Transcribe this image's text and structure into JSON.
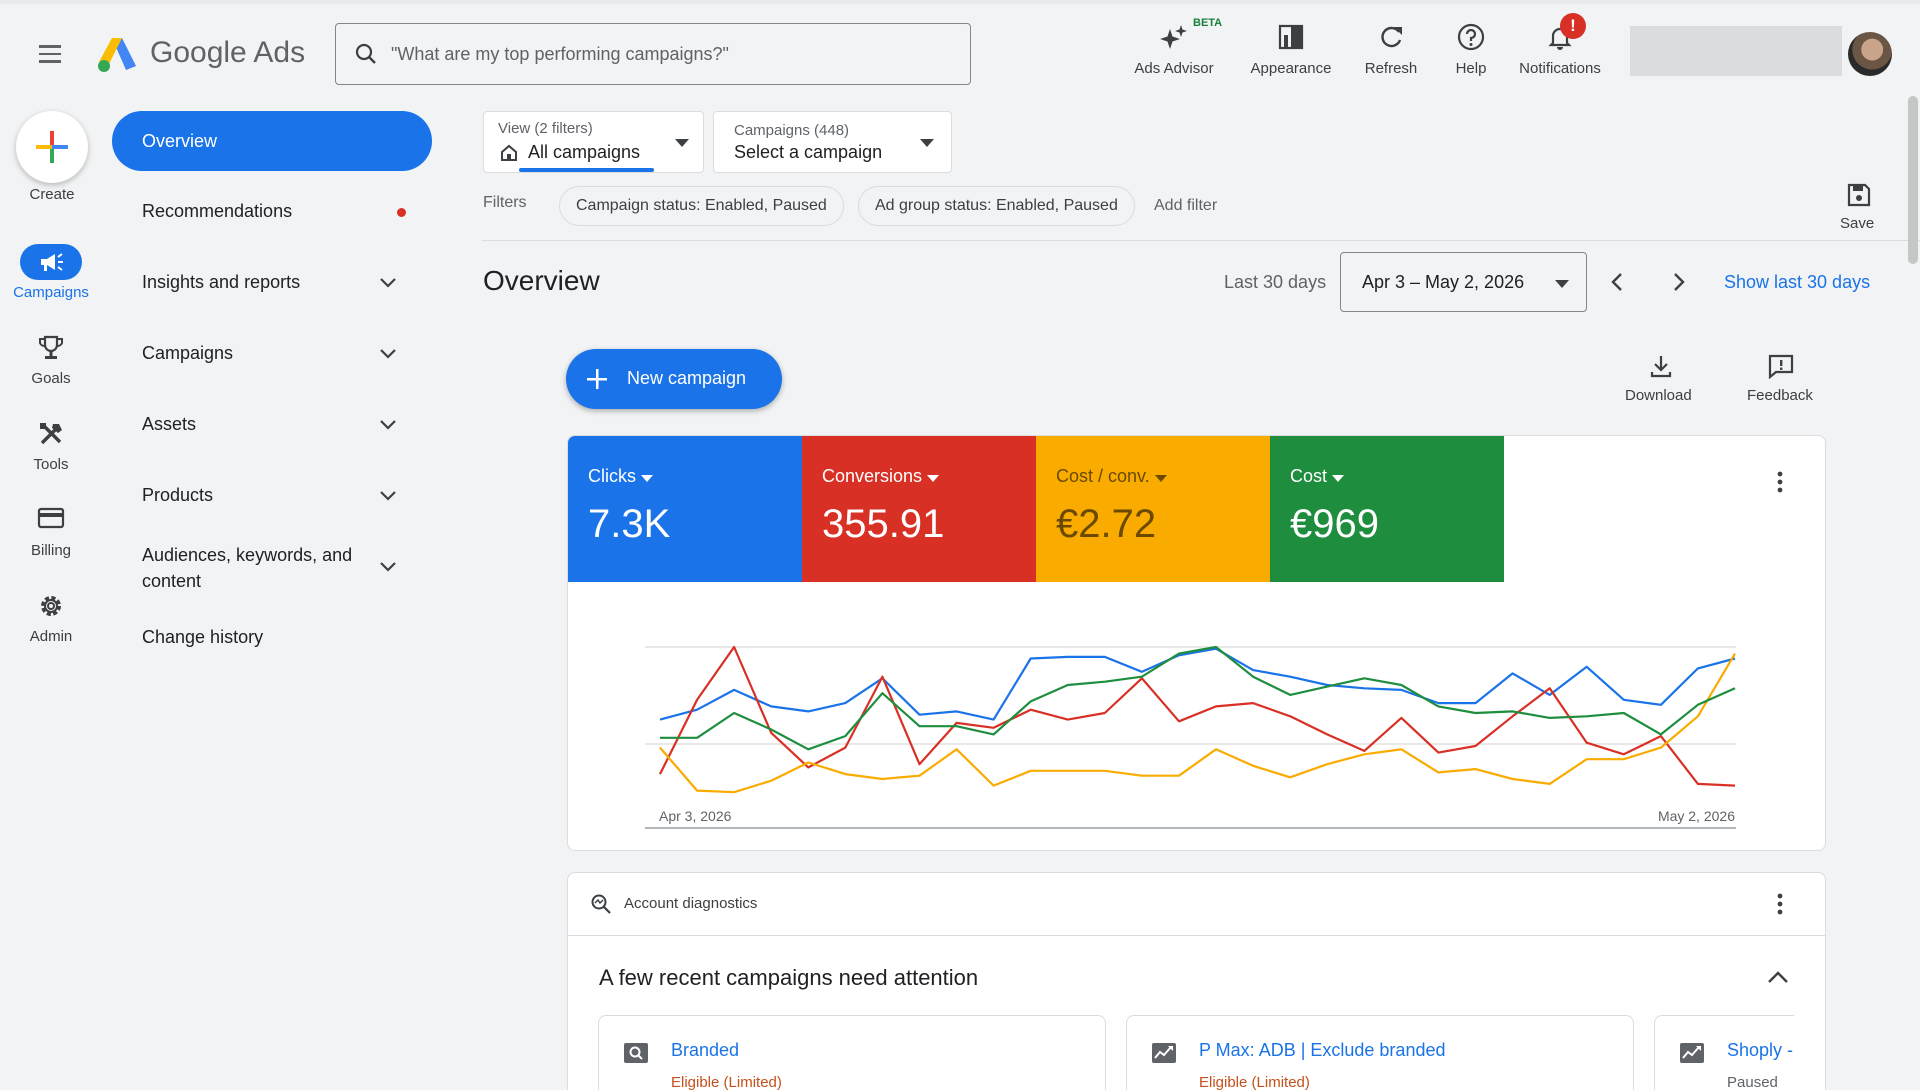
{
  "topbar": {
    "brand": "Google Ads",
    "search_placeholder": "\"What are my top performing campaigns?\"",
    "tools": [
      {
        "label": "Ads Advisor",
        "icon": "sparkle-icon"
      },
      {
        "label": "Appearance",
        "icon": "appearance-icon"
      },
      {
        "label": "Refresh",
        "icon": "refresh-icon"
      },
      {
        "label": "Help",
        "icon": "help-icon"
      },
      {
        "label": "Notifications",
        "icon": "bell-icon"
      }
    ],
    "beta": "BETA",
    "notification_badge": "!"
  },
  "rail": {
    "create": "Create",
    "items": [
      "Campaigns",
      "Goals",
      "Tools",
      "Billing",
      "Admin"
    ]
  },
  "nav": {
    "items": [
      "Overview",
      "Recommendations",
      "Insights and reports",
      "Campaigns",
      "Assets",
      "Products",
      "Audiences, keywords, and content",
      "Change history"
    ]
  },
  "filters": {
    "view_small": "View (2 filters)",
    "view_value": "All campaigns",
    "campaigns_small": "Campaigns (448)",
    "campaigns_value": "Select a campaign",
    "filters_label": "Filters",
    "chips": [
      "Campaign status: Enabled, Paused",
      "Ad group status: Enabled, Paused"
    ],
    "add_filter": "Add filter",
    "save": "Save"
  },
  "overview": {
    "title": "Overview",
    "range_label": "Last 30 days",
    "date_range": "Apr 3 – May 2, 2026",
    "show_last": "Show last 30 days",
    "new_campaign": "New campaign",
    "download": "Download",
    "feedback": "Feedback"
  },
  "metrics": [
    {
      "label": "Clicks",
      "value": "7.3K",
      "color": "#1a73e8"
    },
    {
      "label": "Conversions",
      "value": "355.91",
      "color": "#d93025"
    },
    {
      "label": "Cost / conv.",
      "value": "€2.72",
      "color": "#f9ab00"
    },
    {
      "label": "Cost",
      "value": "€969",
      "color": "#1e8e3e"
    }
  ],
  "chart_data": {
    "type": "line",
    "x_start_label": "Apr 3, 2026",
    "x_end_label": "May 2, 2026",
    "ylim": [
      0,
      1
    ],
    "grid": true,
    "series": [
      {
        "name": "Clicks",
        "color": "#1a73e8",
        "values": [
          0.56,
          0.62,
          0.74,
          0.64,
          0.61,
          0.66,
          0.81,
          0.59,
          0.61,
          0.56,
          0.93,
          0.94,
          0.94,
          0.85,
          0.95,
          0.99,
          0.86,
          0.82,
          0.77,
          0.75,
          0.74,
          0.66,
          0.66,
          0.84,
          0.71,
          0.88,
          0.68,
          0.65,
          0.87,
          0.93
        ]
      },
      {
        "name": "Conversions",
        "color": "#d93025",
        "values": [
          0.23,
          0.68,
          1.0,
          0.48,
          0.27,
          0.39,
          0.82,
          0.29,
          0.54,
          0.51,
          0.62,
          0.56,
          0.6,
          0.81,
          0.55,
          0.64,
          0.66,
          0.58,
          0.47,
          0.37,
          0.57,
          0.36,
          0.4,
          0.58,
          0.75,
          0.42,
          0.35,
          0.46,
          0.17,
          0.16
        ]
      },
      {
        "name": "Cost / conv.",
        "color": "#f9ab00",
        "values": [
          0.39,
          0.13,
          0.12,
          0.19,
          0.3,
          0.23,
          0.2,
          0.22,
          0.38,
          0.16,
          0.25,
          0.25,
          0.25,
          0.22,
          0.22,
          0.38,
          0.28,
          0.21,
          0.29,
          0.35,
          0.38,
          0.24,
          0.26,
          0.2,
          0.17,
          0.32,
          0.32,
          0.39,
          0.58,
          0.96
        ]
      },
      {
        "name": "Cost",
        "color": "#1e8e3e",
        "values": [
          0.45,
          0.45,
          0.6,
          0.5,
          0.38,
          0.46,
          0.72,
          0.52,
          0.52,
          0.47,
          0.67,
          0.77,
          0.79,
          0.82,
          0.96,
          1.0,
          0.82,
          0.71,
          0.76,
          0.81,
          0.77,
          0.64,
          0.6,
          0.61,
          0.57,
          0.58,
          0.6,
          0.47,
          0.65,
          0.75
        ]
      }
    ]
  },
  "diagnostics": {
    "label": "Account diagnostics",
    "heading": "A few recent campaigns need attention",
    "cards": [
      {
        "name": "Branded",
        "status": "Eligible (Limited)"
      },
      {
        "name": "P Max: ADB | Exclude branded",
        "status": "Eligible (Limited)"
      },
      {
        "name": "Shoply -",
        "status": "Paused"
      }
    ]
  }
}
